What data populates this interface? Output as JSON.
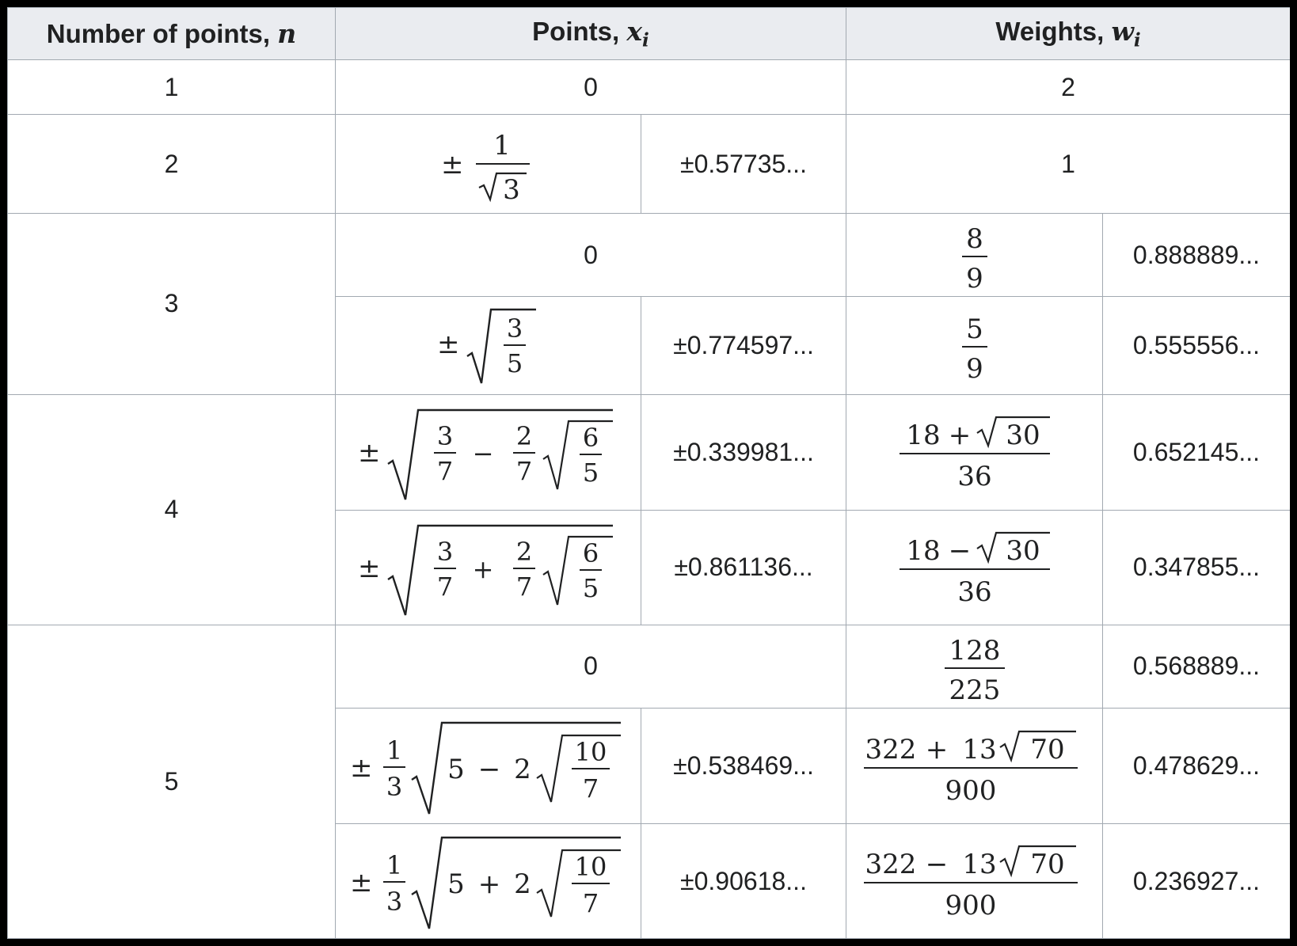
{
  "headers": {
    "n_label": "Number of points, ",
    "n_var": "n",
    "points_label": "Points, ",
    "points_var": "x",
    "points_sub": "i",
    "weights_label": "Weights, ",
    "weights_var": "w",
    "weights_sub": "i"
  },
  "rows": [
    {
      "n": "1",
      "point_decimal": "0",
      "weight_decimal": "2"
    },
    {
      "n": "2",
      "point_exact": "±1/√3",
      "point_decimal": "±0.57735...",
      "weight_decimal": "1"
    },
    {
      "n": "3",
      "point_decimal": "0",
      "weight_exact": "8/9",
      "weight_decimal": "0.888889..."
    },
    {
      "n": "3",
      "point_exact": "±√(3/5)",
      "point_decimal": "±0.774597...",
      "weight_exact": "5/9",
      "weight_decimal": "0.555556..."
    },
    {
      "n": "4",
      "point_exact": "±√(3/7 − 2/7·√(6/5))",
      "point_decimal": "±0.339981...",
      "weight_exact": "(18 + √30)/36",
      "weight_decimal": "0.652145..."
    },
    {
      "n": "4",
      "point_exact": "±√(3/7 + 2/7·√(6/5))",
      "point_decimal": "±0.861136...",
      "weight_exact": "(18 − √30)/36",
      "weight_decimal": "0.347855..."
    },
    {
      "n": "5",
      "point_decimal": "0",
      "weight_exact": "128/225",
      "weight_decimal": "0.568889..."
    },
    {
      "n": "5",
      "point_exact": "±1/3·√(5 − 2√(10/7))",
      "point_decimal": "±0.538469...",
      "weight_exact": "(322 + 13√70)/900",
      "weight_decimal": "0.478629..."
    },
    {
      "n": "5",
      "point_exact": "±1/3·√(5 + 2√(10/7))",
      "point_decimal": "±0.90618...",
      "weight_exact": "(322 − 13√70)/900",
      "weight_decimal": "0.236927..."
    }
  ],
  "math": {
    "pm": "±",
    "minus": "−",
    "plus": "+",
    "one": "1",
    "two": "2",
    "three": "3",
    "five": "5",
    "six": "6",
    "seven": "7",
    "eight": "8",
    "nine": "9",
    "ten": "10",
    "thirteen": "13",
    "eighteen": "18",
    "thirty": "30",
    "thirtysix": "36",
    "seventy": "70",
    "n128": "128",
    "n225": "225",
    "n322": "322",
    "n900": "900"
  }
}
